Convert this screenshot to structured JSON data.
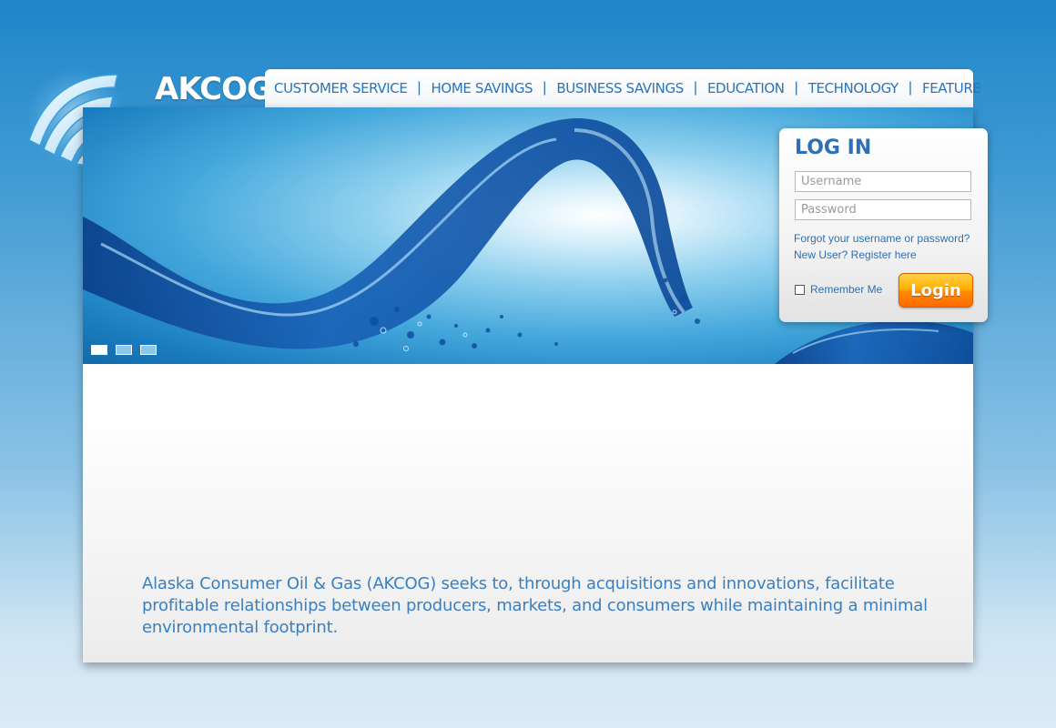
{
  "brand": {
    "name": "AKCOG",
    "logo_icon": "wave-arcs-logo-icon"
  },
  "nav": {
    "items": [
      {
        "label": "CUSTOMER SERVICE"
      },
      {
        "label": "HOME SAVINGS"
      },
      {
        "label": "BUSINESS SAVINGS"
      },
      {
        "label": "EDUCATION"
      },
      {
        "label": "TECHNOLOGY"
      },
      {
        "label": "FEATURE"
      }
    ],
    "separator": "|"
  },
  "hero": {
    "image": "water-splash-wave",
    "slides": 3,
    "active_slide": 1
  },
  "login": {
    "title": "LOG IN",
    "username_placeholder": "Username",
    "password_placeholder": "Password",
    "forgot_link": "Forgot your username or password?",
    "register_link": "New User? Register here",
    "remember_label": "Remember Me",
    "remember_checked": false,
    "submit_label": "Login"
  },
  "mission": {
    "text": "Alaska Consumer Oil & Gas (AKCOG) seeks to, through acquisitions and innovations, facilitate profitable relationships between producers, markets, and consumers while maintaining a minimal environmental footprint."
  },
  "colors": {
    "accent": "#2f6fb3",
    "background_top": "#1f86c9",
    "background_bottom": "#dcebf6",
    "login_button": "#ff8a00"
  }
}
